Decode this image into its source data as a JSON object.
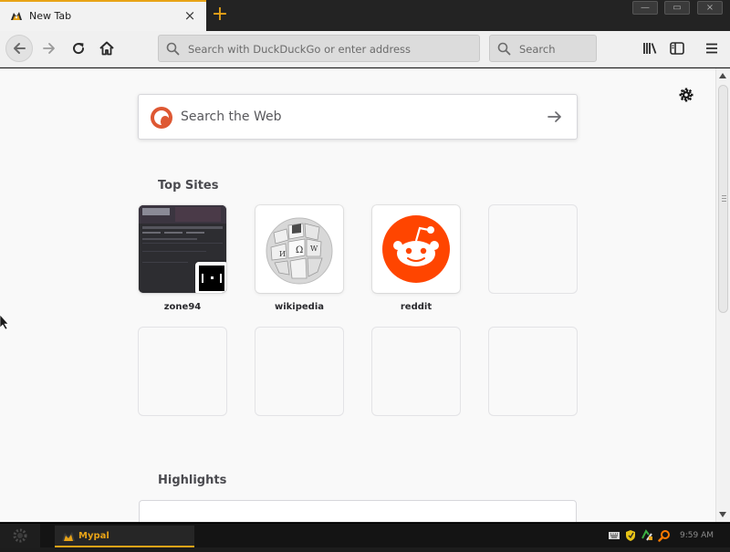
{
  "tab": {
    "title": "New Tab",
    "close": "×",
    "new_tab": "+"
  },
  "window_controls": {
    "minimize": "—",
    "restore": "▭",
    "close": "×"
  },
  "navbar": {
    "url_placeholder": "Search with DuckDuckGo or enter address",
    "search_placeholder": "Search"
  },
  "newtab": {
    "web_search_placeholder": "Search the Web",
    "top_sites_heading": "Top Sites",
    "highlights_heading": "Highlights",
    "top_sites": [
      {
        "label": "zone94"
      },
      {
        "label": "wikipedia"
      },
      {
        "label": "reddit"
      },
      {
        "label": ""
      }
    ]
  },
  "taskbar": {
    "app_label": "Mypal",
    "clock": "9:59 AM"
  },
  "colors": {
    "accent": "#e8a317",
    "duckduckgo": "#de5833",
    "reddit": "#ff4500"
  }
}
